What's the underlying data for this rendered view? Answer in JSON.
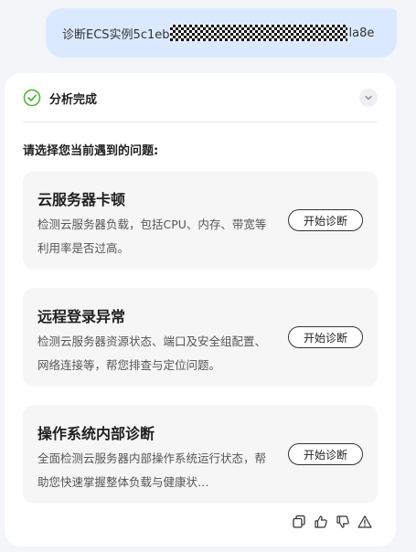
{
  "user_message": {
    "prefix": "诊断ECS实例5c1eb",
    "suffix": "la8e"
  },
  "response": {
    "status": "分析完成",
    "prompt": "请选择您当前遇到的问题:",
    "options": [
      {
        "title": "云服务器卡顿",
        "description": "检测云服务器负载，包括CPU、内存、带宽等利用率是否过高。",
        "button": "开始诊断"
      },
      {
        "title": "远程登录异常",
        "description": "检测云服务器资源状态、端口及安全组配置、网络连接等，帮您排查与定位问题。",
        "button": "开始诊断"
      },
      {
        "title": "操作系统内部诊断",
        "description": "全面检测云服务器内部操作系统运行状态，帮助您快速掌握整体负载与健康状…",
        "button": "开始诊断"
      }
    ]
  },
  "icons": {
    "status": "check-circle-icon",
    "collapse": "chevron-down-icon",
    "actions": [
      "copy-icon",
      "thumbs-up-icon",
      "thumbs-down-icon",
      "warning-icon"
    ]
  },
  "colors": {
    "user_bubble": "#dbe9ff",
    "success_green": "#52b43a",
    "page_background": "#f3f5f8"
  }
}
